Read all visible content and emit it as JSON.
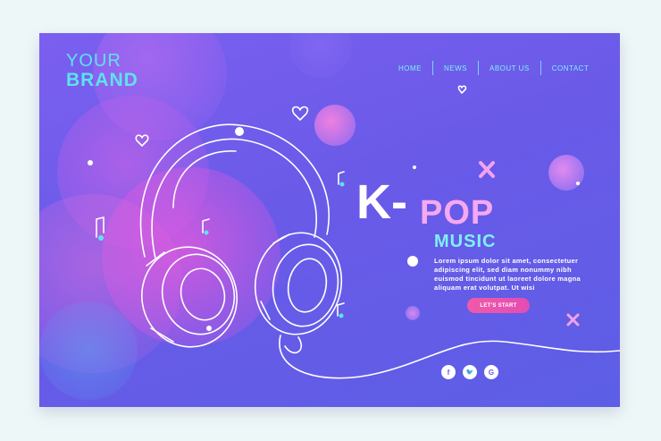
{
  "brand": {
    "line1": "YOUR",
    "line2": "BRAND"
  },
  "nav": {
    "items": [
      {
        "label": "HOME"
      },
      {
        "label": "NEWS"
      },
      {
        "label": "ABOUT US"
      },
      {
        "label": "CONTACT"
      }
    ]
  },
  "hero": {
    "title_k": "K-",
    "title_pop": "POP",
    "subtitle": "MUSIC",
    "description": "Lorem ipsum dolor sit amet, consectetuer adipiscing elit, sed diam nonummy nibh euismod tincidunt ut laoreet dolore magna aliquam erat volutpat. Ut wisi",
    "cta_label": "LET'S START"
  },
  "social": [
    {
      "icon": "facebook-icon",
      "glyph": "f"
    },
    {
      "icon": "twitter-icon",
      "glyph": "🐦"
    },
    {
      "icon": "google-icon",
      "glyph": "G"
    }
  ],
  "colors": {
    "background": "#6a5ae8",
    "accent_cyan": "#5de3f0",
    "accent_pink": "#f6a8f0",
    "cta": "#f05aa8"
  }
}
